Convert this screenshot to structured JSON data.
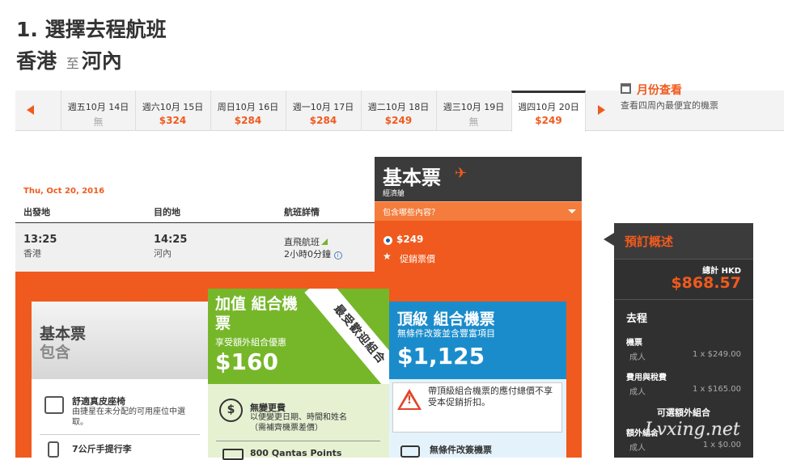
{
  "header": {
    "step_title": "1. 選擇去程航班",
    "origin": "香港",
    "to": "至",
    "destination": "河內"
  },
  "date_bar": {
    "dates": [
      {
        "label": "週五10月 14日",
        "price": "無"
      },
      {
        "label": "週六10月 15日",
        "price": "$324"
      },
      {
        "label": "周日10月 16日",
        "price": "$284"
      },
      {
        "label": "週一10月 17日",
        "price": "$284"
      },
      {
        "label": "週二10月 18日",
        "price": "$249"
      },
      {
        "label": "週三10月 19日",
        "price": "無"
      },
      {
        "label": "週四10月 20日",
        "price": "$249"
      }
    ],
    "month_view_label": "月份查看",
    "month_view_sub": "查看四周內最便宜的機票"
  },
  "flight": {
    "date": "Thu, Oct 20, 2016",
    "headers": {
      "depart": "出發地",
      "arrive": "目的地",
      "details": "航班詳情"
    },
    "depart_time": "13:25",
    "depart_city": "香港",
    "arrive_time": "14:25",
    "arrive_city": "河內",
    "type": "直飛航班",
    "duration": "2小時0分鐘"
  },
  "fare": {
    "name": "基本票",
    "sub": "經濟艙",
    "dropdown": "包含哪些內容？",
    "price": "$249",
    "promo": "促銷票價"
  },
  "cards": {
    "basic": {
      "title1": "基本票",
      "title2": "包含",
      "features": [
        {
          "title": "舒適真皮座椅",
          "desc": "由捷星在未分配的可用座位中選取。"
        },
        {
          "title": "7公斤手提行李",
          "desc": ""
        }
      ]
    },
    "plus": {
      "title": "加值 組合機票",
      "sub": "享受額外組合優惠",
      "price": "$160",
      "ribbon": "最受歡迎組合",
      "feature1_title": "無變更費",
      "feature1_desc1": "以便變更日期、時間和姓名",
      "feature1_desc2": "（需補齊機票差價）",
      "feature2_title": "800 Qantas Points"
    },
    "max": {
      "title": "頂級 組合機票",
      "sub": "無條件改簽並含豐富項目",
      "price": "$1,125",
      "warning": "帶頂級組合機票的應付總價不享受本促銷折扣。",
      "feature1_title": "無條件改簽機票"
    }
  },
  "summary": {
    "title": "預訂概述",
    "total_label": "總計 HKD",
    "total": "$868.57",
    "section": "去程",
    "items": [
      {
        "label": "機票",
        "row": "成人",
        "value": "1 x $249.00"
      },
      {
        "label": "費用與稅費",
        "row": "成人",
        "value": "1 x $165.00"
      }
    ],
    "optional_label": "可選額外組合",
    "extra": {
      "label": "額外組合",
      "row": "成人",
      "value": "1 x $0.00"
    }
  },
  "watermark": "Lvxing.net",
  "colors": {
    "accent": "#f05a1e",
    "plus_green": "#76b72a",
    "max_blue": "#1b8ccb",
    "dark": "#3c3b3b"
  }
}
